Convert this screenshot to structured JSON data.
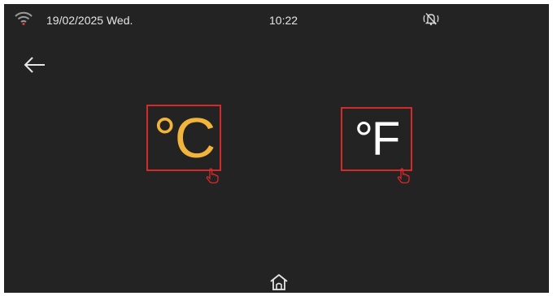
{
  "status_bar": {
    "wifi_icon": "wifi-icon",
    "date": "19/02/2025 Wed.",
    "time": "10:22",
    "bell_icon": "bell-muted-icon"
  },
  "navigation": {
    "back_icon": "arrow-left-icon",
    "home_icon": "home-icon"
  },
  "units": {
    "celsius_symbol": "°C",
    "fahrenheit_symbol": "°F",
    "selected": "celsius",
    "touch_hint_icon": "hand-pointer-icon"
  },
  "colors": {
    "background": "#232323",
    "selected_unit": "#f2b43a",
    "unselected_unit": "#ffffff",
    "highlight_box": "#d42a2a",
    "wifi_accent": "#d43a3a"
  }
}
